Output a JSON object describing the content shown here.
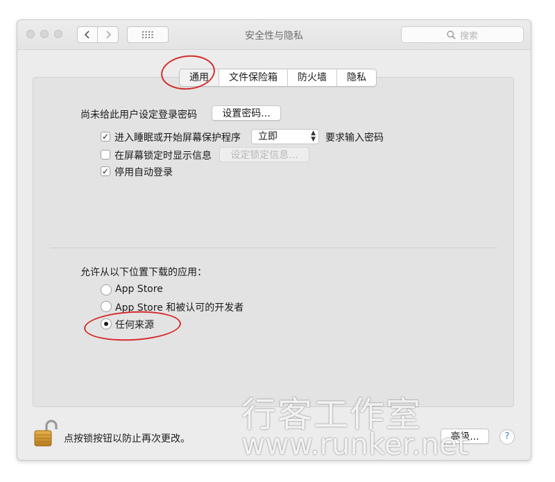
{
  "window": {
    "title": "安全性与隐私"
  },
  "search": {
    "placeholder": "搜索",
    "icon": "search-icon"
  },
  "tabs": [
    {
      "label": "通用",
      "active": true
    },
    {
      "label": "文件保险箱",
      "active": false
    },
    {
      "label": "防火墙",
      "active": false
    },
    {
      "label": "隐私",
      "active": false
    }
  ],
  "general": {
    "login_password_text": "尚未给此用户设定登录密码",
    "set_password_button": "设置密码...",
    "require_password": {
      "checked": true,
      "label": "进入睡眠或开始屏幕保护程序",
      "delay_value": "立即",
      "suffix": "要求输入密码"
    },
    "lock_message": {
      "checked": false,
      "label": "在屏幕锁定时显示信息",
      "button": "设定锁定信息..."
    },
    "disable_auto_login": {
      "checked": true,
      "label": "停用自动登录"
    }
  },
  "downloads": {
    "heading": "允许从以下位置下载的应用：",
    "options": [
      {
        "label": "App Store",
        "selected": false
      },
      {
        "label": "App Store 和被认可的开发者",
        "selected": false
      },
      {
        "label": "任何来源",
        "selected": true
      }
    ]
  },
  "footer": {
    "lock_text": "点按锁按钮以防止再次更改。",
    "advanced_button": "高级...",
    "help_button": "?"
  },
  "watermark": {
    "line1": "行客工作室",
    "line2": "www.runker.net"
  },
  "colors": {
    "annotation_red": "#d42c2c",
    "window_bg": "#ececec",
    "panel_bg": "#e3e3e3"
  }
}
